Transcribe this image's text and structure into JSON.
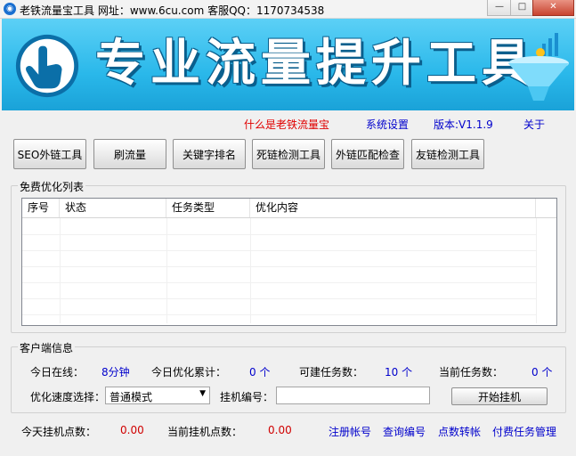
{
  "window": {
    "title": "老铁流量宝工具 网址：www.6cu.com 客服QQ：1170734538",
    "min_label": "—",
    "max_label": "□",
    "close_label": "✕"
  },
  "banner": {
    "title": "专业流量提升工具",
    "icons": [
      "hand-pointer-icon",
      "funnel-chart-icon"
    ]
  },
  "menu": {
    "what": "什么是老铁流量宝",
    "settings": "系统设置",
    "version": "版本:V1.1.9",
    "about": "关于"
  },
  "toolbar": [
    "SEO外链工具",
    "刷流量",
    "关键字排名",
    "死链检测工具",
    "外链匹配检查",
    "友链检测工具"
  ],
  "task_list": {
    "group_title": "免费优化列表",
    "columns": [
      "序号",
      "状态",
      "任务类型",
      "优化内容"
    ],
    "rows": []
  },
  "client_info": {
    "group_title": "客户端信息",
    "today_online_label": "今日在线：",
    "today_online_value": "8分钟",
    "today_opt_label": "今日优化累计：",
    "today_opt_value": "0 个",
    "creatable_label": "可建任务数：",
    "creatable_value": "10 个",
    "current_tasks_label": "当前任务数：",
    "current_tasks_value": "0 个",
    "speed_label": "优化速度选择：",
    "speed_value": "普通模式",
    "machine_label": "挂机编号：",
    "machine_value": "",
    "start_button": "开始挂机"
  },
  "footer": {
    "today_points_label": "今天挂机点数：",
    "today_points_value": "0.00",
    "current_points_label": "当前挂机点数：",
    "current_points_value": "0.00",
    "links": [
      "注册帐号",
      "查询编号",
      "点数转帐",
      "付费任务管理"
    ]
  },
  "colors": {
    "banner_blue": "#2ab8ea",
    "link_blue": "#0000cc",
    "value_red": "#d00000",
    "menu_red": "#e00000"
  }
}
